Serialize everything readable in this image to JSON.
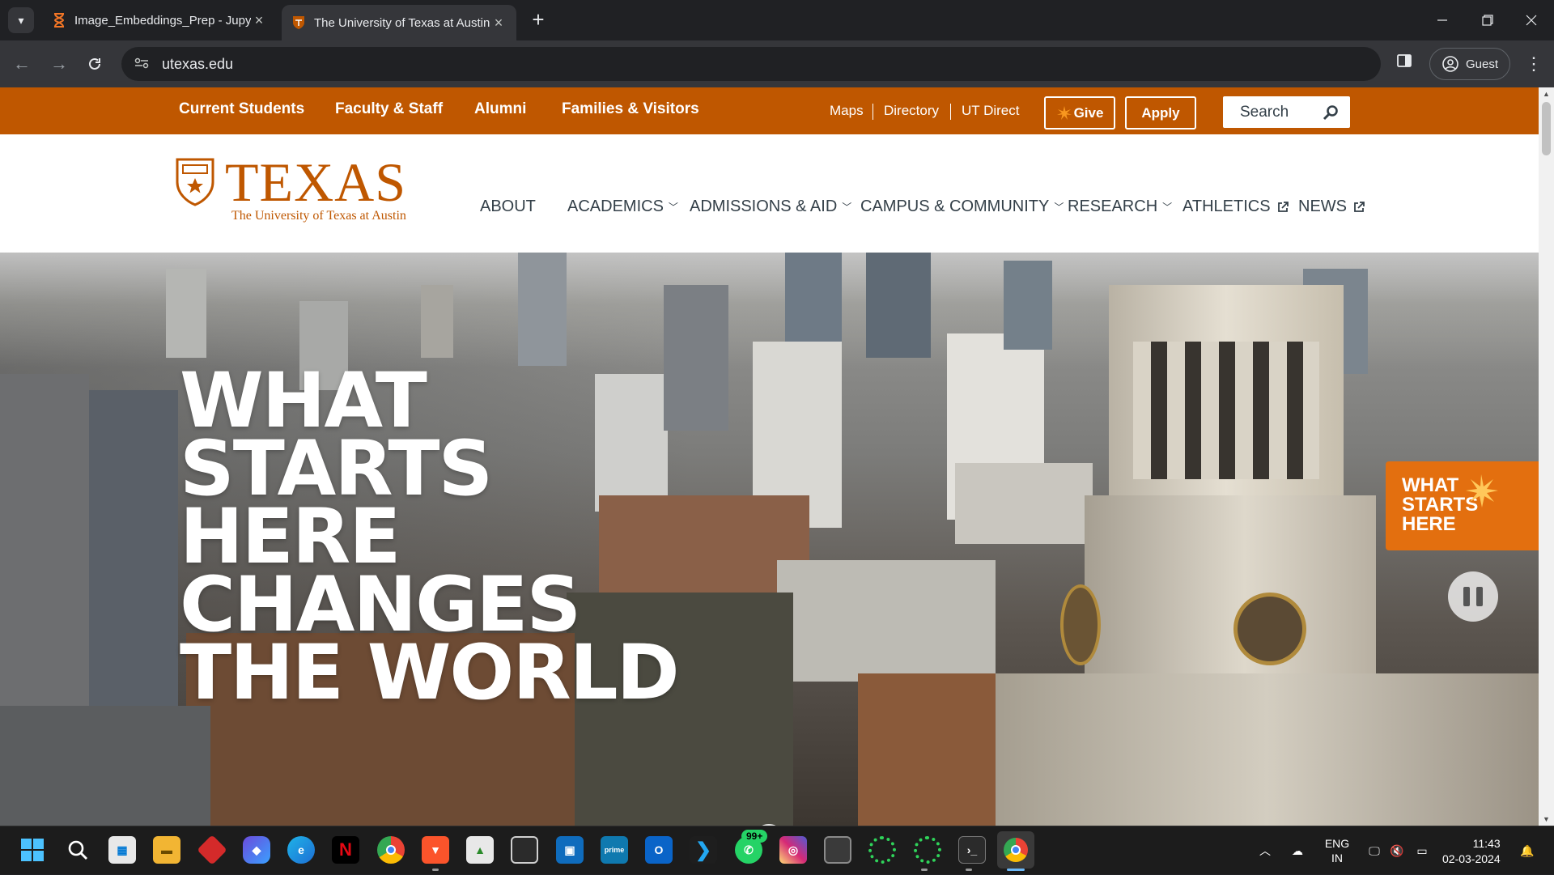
{
  "browser": {
    "tabs": [
      {
        "title": "Image_Embeddings_Prep - Jupyter",
        "active": false
      },
      {
        "title": "The University of Texas at Austin",
        "active": true
      }
    ],
    "url": "utexas.edu",
    "profile_label": "Guest"
  },
  "site": {
    "utility_nav": [
      "Current Students",
      "Faculty & Staff",
      "Alumni",
      "Families & Visitors"
    ],
    "utility_links": [
      "Maps",
      "Directory",
      "UT Direct"
    ],
    "give_label": "Give",
    "apply_label": "Apply",
    "search_placeholder": "Search",
    "logo_word": "TEXAS",
    "logo_subtitle": "The University of Texas at Austin",
    "main_nav": [
      {
        "label": "ABOUT",
        "suffix": "none"
      },
      {
        "label": "ACADEMICS",
        "suffix": "chevron"
      },
      {
        "label": "ADMISSIONS & AID",
        "suffix": "chevron"
      },
      {
        "label": "CAMPUS & COMMUNITY",
        "suffix": "chevron"
      },
      {
        "label": "RESEARCH",
        "suffix": "chevron"
      },
      {
        "label": "ATHLETICS",
        "suffix": "external"
      },
      {
        "label": "NEWS",
        "suffix": "external"
      }
    ],
    "hero_lines": [
      "WHAT",
      "STARTS",
      "HERE",
      "CHANGES",
      "THE WORLD"
    ],
    "badge_lines": [
      "WHAT",
      "STARTS",
      "HERE"
    ]
  },
  "taskbar": {
    "notification_badge": "99+",
    "language": "ENG",
    "region": "IN",
    "time": "11:43",
    "date": "02-03-2024"
  },
  "colors": {
    "burnt_orange": "#bf5700",
    "badge_orange": "#e36f0f",
    "nav_text": "#333f48"
  }
}
